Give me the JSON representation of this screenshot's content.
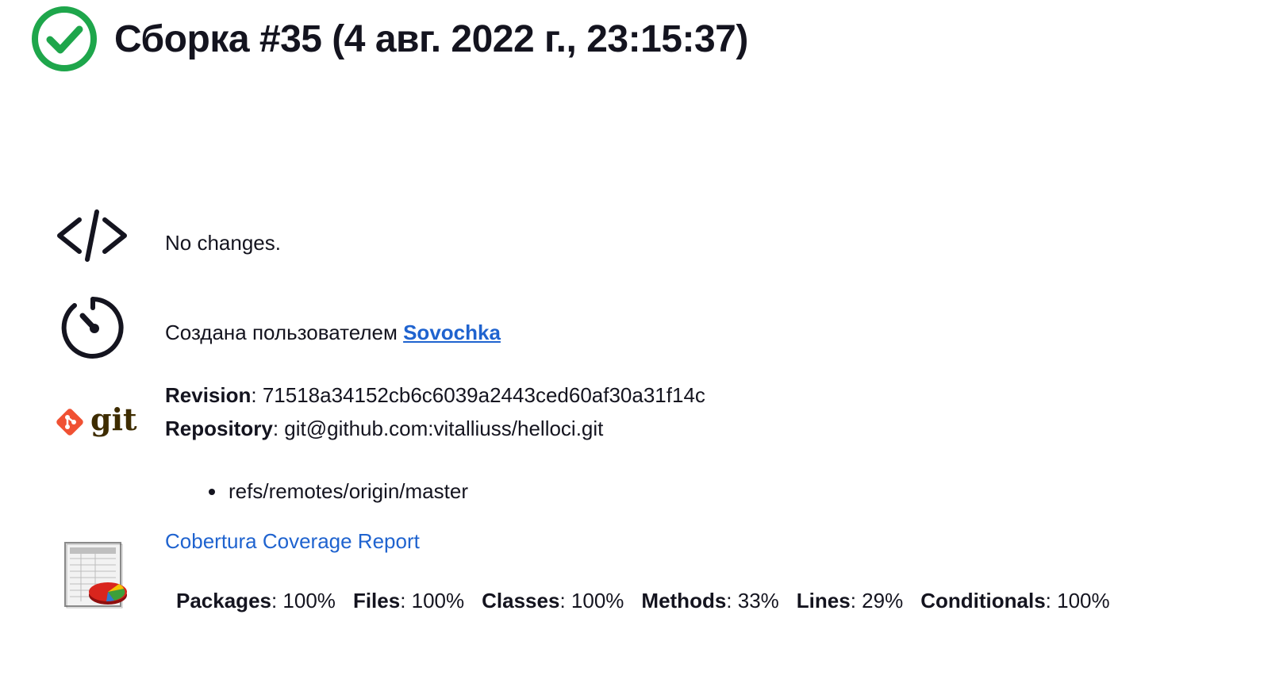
{
  "title": "Сборка #35 (4 авг. 2022 г., 23:15:37)",
  "status": {
    "icon": "success-check-icon",
    "color": "#1ea64b"
  },
  "changes": {
    "icon": "code-icon",
    "text": "No changes."
  },
  "cause": {
    "icon": "timer-icon",
    "prefix": "Создана пользователем ",
    "user": "Sovochka"
  },
  "git": {
    "icon": "git-logo-icon",
    "revision_label": "Revision",
    "revision_value": ": 71518a34152cb6c6039a2443ced60af30a31f14c",
    "repository_label": "Repository",
    "repository_value": ": git@github.com:vitalliuss/helloci.git",
    "branches": [
      "refs/remotes/origin/master"
    ],
    "logo_text": "git"
  },
  "coverage": {
    "icon": "coverage-report-icon",
    "link": "Cobertura Coverage Report",
    "stats": [
      {
        "label": "Packages",
        "value": ": 100%"
      },
      {
        "label": "Files",
        "value": ": 100%"
      },
      {
        "label": "Classes",
        "value": ": 100%"
      },
      {
        "label": "Methods",
        "value": ": 33%"
      },
      {
        "label": "Lines",
        "value": ": 29%"
      },
      {
        "label": "Conditionals",
        "value": ": 100%"
      }
    ]
  }
}
